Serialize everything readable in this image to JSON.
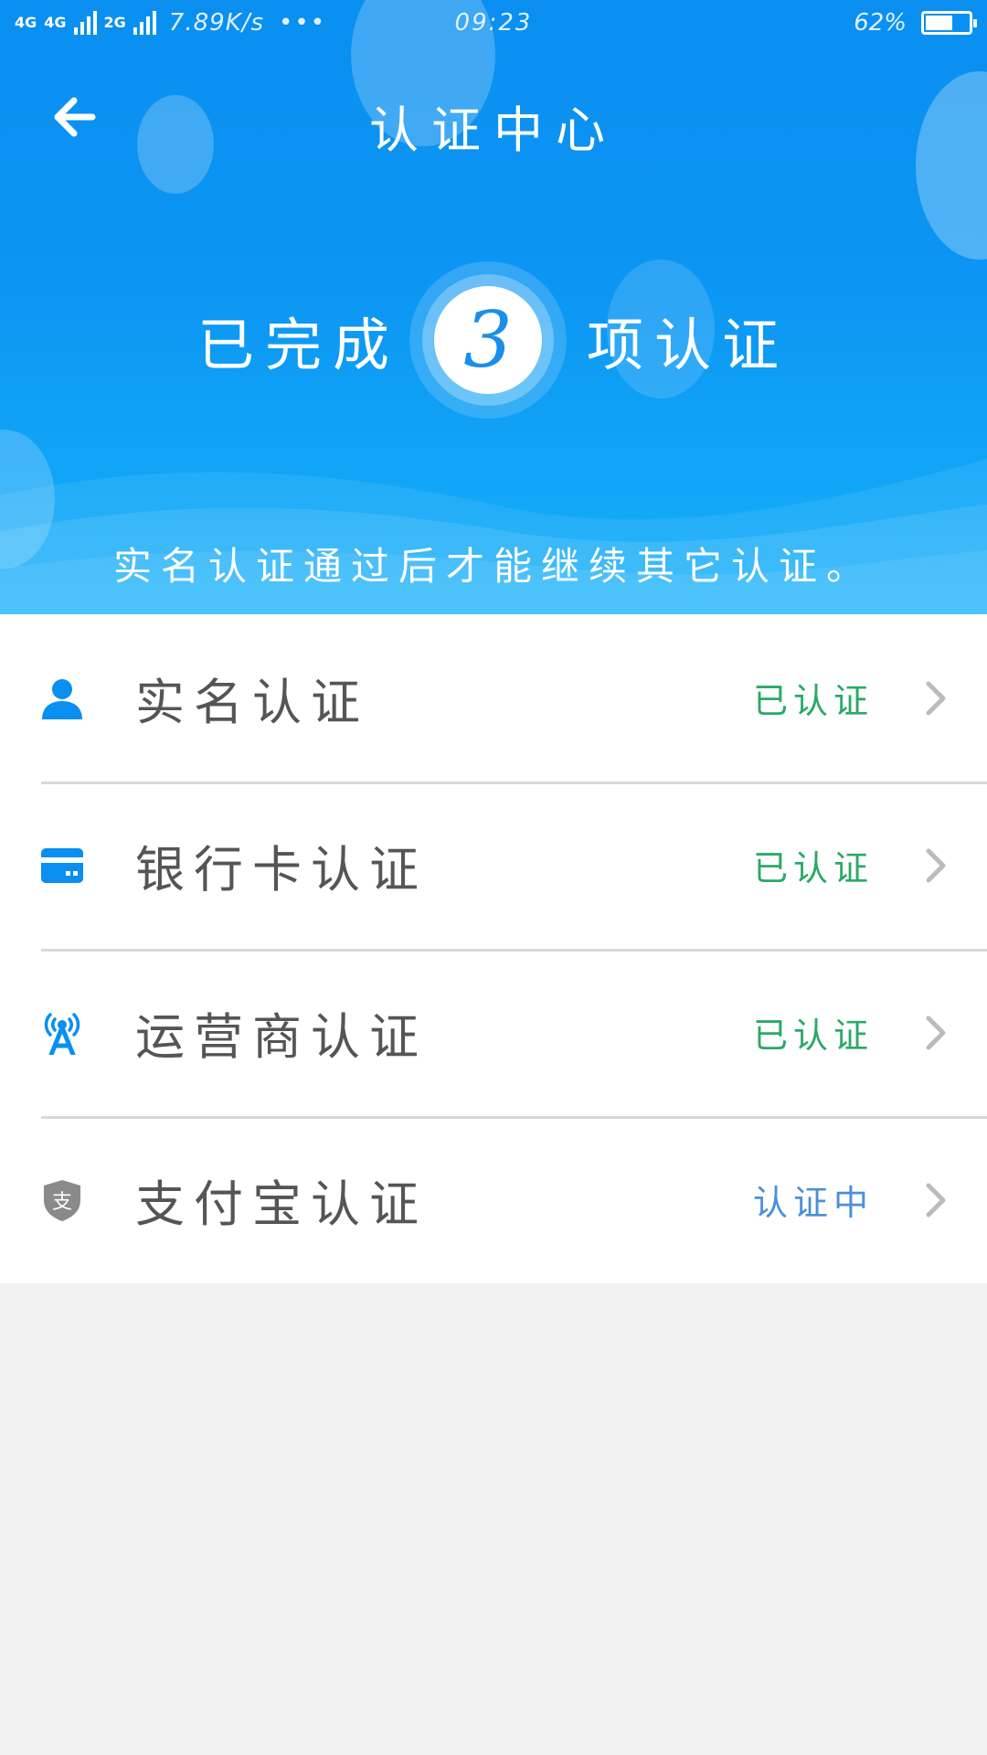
{
  "status_bar": {
    "network_1": "4G",
    "network_2": "4G",
    "network_3": "2G",
    "speed": "7.89K/s",
    "more": "•••",
    "time": "09:23",
    "battery_text": "62%",
    "battery_level": 0.62
  },
  "header": {
    "title": "认证中心",
    "progress_prefix": "已完成",
    "completed_count": "3",
    "progress_suffix": "项认证",
    "subtitle": "实名认证通过后才能继续其它认证。"
  },
  "colors": {
    "primary": "#0a8ff0",
    "verified": "#2aa966",
    "pending": "#4a90d9",
    "alipay_icon": "#8a8a8a",
    "chevron": "#bbbbbb"
  },
  "items": [
    {
      "label": "实名认证",
      "status": "已认证",
      "status_color": "#2aa966",
      "icon": "person-icon"
    },
    {
      "label": "银行卡认证",
      "status": "已认证",
      "status_color": "#2aa966",
      "icon": "bank-card-icon"
    },
    {
      "label": "运营商认证",
      "status": "已认证",
      "status_color": "#2aa966",
      "icon": "signal-tower-icon"
    },
    {
      "label": "支付宝认证",
      "status": "认证中",
      "status_color": "#4a90d9",
      "icon": "alipay-shield-icon"
    }
  ],
  "alipay_icon_glyph": "支"
}
